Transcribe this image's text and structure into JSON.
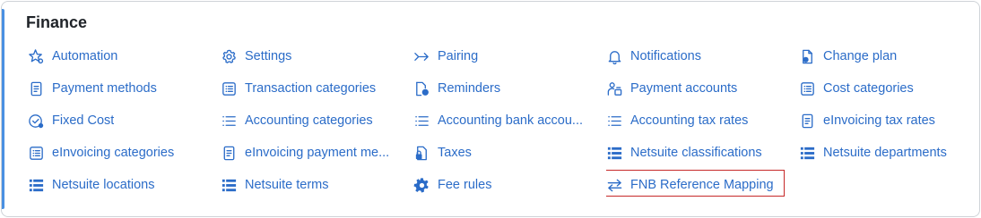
{
  "section": {
    "title": "Finance"
  },
  "colors": {
    "link": "#2b6cc8",
    "accent_bar": "#4a90e2",
    "highlight_border": "#c62828"
  },
  "items": [
    {
      "label": "Automation",
      "icon": "star-gear-icon"
    },
    {
      "label": "Settings",
      "icon": "gear-icon"
    },
    {
      "label": "Pairing",
      "icon": "double-arrow-right-icon"
    },
    {
      "label": "Notifications",
      "icon": "bell-icon"
    },
    {
      "label": "Change plan",
      "icon": "document-cycle-icon"
    },
    {
      "label": "Payment methods",
      "icon": "document-icon"
    },
    {
      "label": "Transaction categories",
      "icon": "list-box-icon"
    },
    {
      "label": "Reminders",
      "icon": "document-clock-icon"
    },
    {
      "label": "Payment accounts",
      "icon": "people-card-icon"
    },
    {
      "label": "Cost categories",
      "icon": "list-box-icon"
    },
    {
      "label": "Fixed Cost",
      "icon": "check-gear-icon"
    },
    {
      "label": "Accounting categories",
      "icon": "list-icon"
    },
    {
      "label": "Accounting bank accou...",
      "icon": "list-icon"
    },
    {
      "label": "Accounting tax rates",
      "icon": "list-icon"
    },
    {
      "label": "eInvoicing tax rates",
      "icon": "document-icon"
    },
    {
      "label": "eInvoicing categories",
      "icon": "list-box-icon"
    },
    {
      "label": "eInvoicing payment me...",
      "icon": "document-icon"
    },
    {
      "label": "Taxes",
      "icon": "document-lock-icon"
    },
    {
      "label": "Netsuite classifications",
      "icon": "list-solid-icon"
    },
    {
      "label": "Netsuite departments",
      "icon": "list-solid-icon"
    },
    {
      "label": "Netsuite locations",
      "icon": "list-solid-icon"
    },
    {
      "label": "Netsuite terms",
      "icon": "list-solid-icon"
    },
    {
      "label": "Fee rules",
      "icon": "gear-solid-icon"
    },
    {
      "label": "FNB Reference Mapping",
      "icon": "swap-arrows-icon",
      "highlighted": true
    }
  ]
}
